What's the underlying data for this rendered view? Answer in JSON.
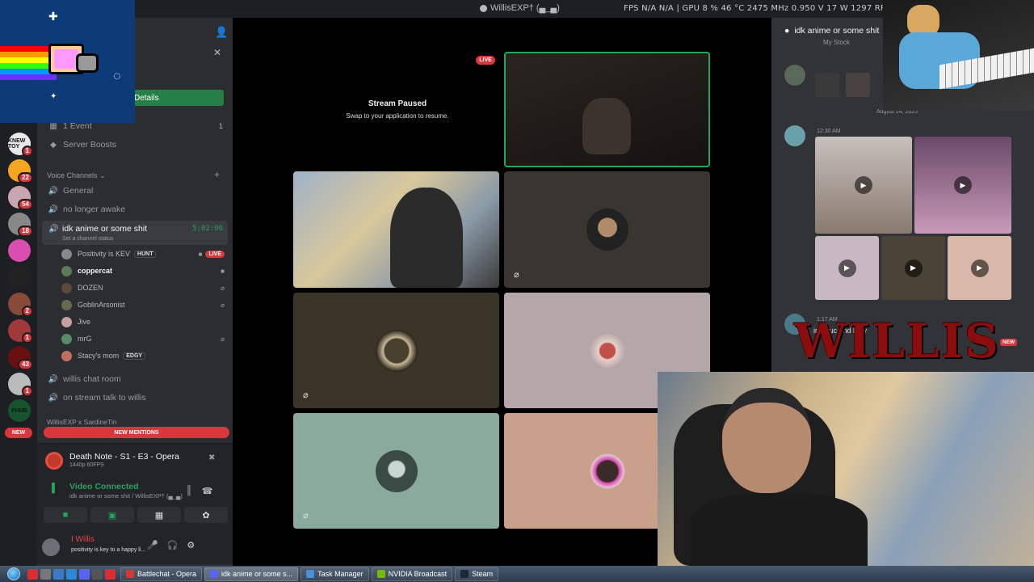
{
  "titlebar": {
    "window_title": "WillisEXP† (▄_▄)",
    "stats": "FPS  N/A  N/A  |  GPU  8 %  46 °C  2475 MHz  0.950 V  17 W  1297 RPM  1"
  },
  "servers": [
    {
      "label": "KNEW TOY",
      "badge": "1",
      "color": "#e8e8e8"
    },
    {
      "label": "",
      "badge": "22",
      "color": "#f4a620"
    },
    {
      "label": "",
      "badge": "54",
      "color": "#c8a6b0"
    },
    {
      "label": "",
      "badge": "18",
      "color": "#888888"
    },
    {
      "label": "",
      "badge": "",
      "color": "#d94fb0"
    },
    {
      "label": "",
      "badge": "",
      "color": "#222222"
    },
    {
      "label": "",
      "badge": "2",
      "color": "#8a4a3a"
    },
    {
      "label": "",
      "badge": "1",
      "color": "#a03a3a"
    },
    {
      "label": "",
      "badge": "43",
      "color": "#6b1010"
    },
    {
      "label": "",
      "badge": "1",
      "color": "#bbbbbb"
    },
    {
      "label": "FHUB",
      "badge": "",
      "color": "#14552e"
    }
  ],
  "new_pill": "NEW",
  "sidebar": {
    "details_button": "Details",
    "events": "1 Event",
    "events_count": "1",
    "boosts": "Server Boosts",
    "voice_header": "Voice Channels",
    "channels": [
      {
        "name": "General"
      },
      {
        "name": "no longer awake"
      }
    ],
    "active_channel": {
      "name": "idk anime or some shit",
      "timer": "5:02:06",
      "status": "Set a channel status"
    },
    "users": [
      {
        "name": "Positivity is KEV",
        "tag": "HUNT",
        "live": "LIVE",
        "color": "#888"
      },
      {
        "name": "coppercat",
        "tag": "",
        "live": "",
        "color": "#5a7a5a"
      },
      {
        "name": "DOZEN",
        "tag": "",
        "live": "",
        "color": "#5a4a3a"
      },
      {
        "name": "GoblinArsonist",
        "tag": "",
        "live": "",
        "color": "#6a6a50"
      },
      {
        "name": "Jive",
        "tag": "",
        "live": "",
        "color": "#c8a0a0"
      },
      {
        "name": "mrG",
        "tag": "",
        "live": "",
        "color": "#5a8a6a"
      },
      {
        "name": "Stacy's mom",
        "tag": "EDGY",
        "live": "",
        "color": "#c07060"
      }
    ],
    "more_channels": [
      {
        "name": "willis chat room"
      },
      {
        "name": "on stream talk to willis"
      }
    ],
    "category": "WillisEXP x SardineTin",
    "new_mentions": "NEW MENTIONS"
  },
  "activity": {
    "game": "Death Note - S1 - E3 - Opera",
    "resolution": "1440p 60FPS",
    "voice_status": "Video Connected",
    "voice_sub": "idk anime or some shit / WillisEXP† (▄_▄)"
  },
  "user": {
    "name": "I Willis",
    "status": "positivity is key to a happy li..."
  },
  "stage": {
    "paused_title": "Stream Paused",
    "paused_sub": "Swap to your application to resume.",
    "live": "LIVE"
  },
  "chat": {
    "channel": "idk anime or some shit",
    "top_text": "My Stock",
    "date": "August 14, 2025",
    "time1": "12:30 AM",
    "time2": "1:17 AM",
    "snippet": "ing duc   and h   ay",
    "new_tag": "NEW",
    "logo": "WILLIS"
  },
  "taskbar": {
    "tasks": [
      {
        "label": "Battlechat - Opera",
        "icon": "#d93636",
        "active": false
      },
      {
        "label": "idk anime or some s...",
        "icon": "#5865f2",
        "active": true
      },
      {
        "label": "Task Manager",
        "icon": "#4a90d9",
        "active": false
      },
      {
        "label": "NVIDIA Broadcast",
        "icon": "#76b900",
        "active": false
      },
      {
        "label": "Steam",
        "icon": "#1b2838",
        "active": false
      }
    ]
  }
}
